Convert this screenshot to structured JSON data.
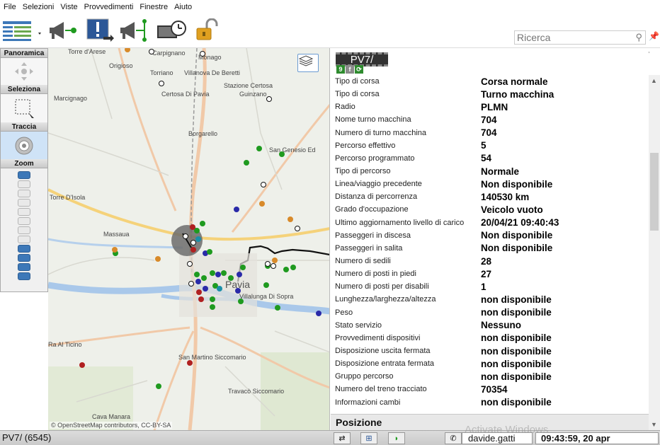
{
  "menu": [
    "File",
    "Selezioni",
    "Viste",
    "Provvedimenti",
    "Finestre",
    "Aiuto"
  ],
  "search": {
    "placeholder": "Ricerca"
  },
  "left_panel": {
    "panoramica": "Panoramica",
    "seleziona": "Seleziona",
    "traccia": "Traccia",
    "zoom": "Zoom",
    "zoom_levels": 12,
    "zoom_active_from": 8
  },
  "map": {
    "place_labels": [
      "Carpignano",
      "Monago",
      "Torre d'Arese",
      "Origioso",
      "Torriano",
      "Villanova De Beretti",
      "Stazione Certosa",
      "Certosa Di Pavia",
      "Guinzano",
      "Marcignago",
      "Borgarello",
      "San Genesio Ed",
      "Torre D'Isola",
      "Massaua",
      "Pavia",
      "Villalunga Di Sopra",
      "Ra Al Ticino",
      "San Martino Siccomario",
      "Travacò Siccomario",
      "Cava Manara"
    ],
    "attribution": "© OpenStreetMap contributors, CC-BY-SA"
  },
  "details": {
    "vehicle_id": "PV7/",
    "badges": [
      {
        "text": "9",
        "color": "#2e8b2e"
      },
      {
        "text": "f",
        "color": "#8a8a8a"
      },
      {
        "text": "⟳",
        "color": "#2e8b2e"
      }
    ],
    "rows": [
      {
        "label": "Tipo di corsa",
        "value": "Corsa normale"
      },
      {
        "label": "Tipo di corsa",
        "value": "Turno macchina"
      },
      {
        "label": "Radio",
        "value": "PLMN"
      },
      {
        "label": "Nome turno macchina",
        "value": "704"
      },
      {
        "label": "Numero di turno macchina",
        "value": "704"
      },
      {
        "label": "Percorso effettivo",
        "value": "5"
      },
      {
        "label": "Percorso programmato",
        "value": "54"
      },
      {
        "label": "Tipo di percorso",
        "value": "Normale"
      },
      {
        "label": "Linea/viaggio precedente",
        "value": "Non disponibile"
      },
      {
        "label": "Distanza di percorrenza",
        "value": "140530 km"
      },
      {
        "label": "Grado d'occupazione",
        "value": "Veicolo vuoto"
      },
      {
        "label": "Ultimo aggiornamento livello di carico",
        "value": "20/04/21 09:40:43"
      },
      {
        "label": "Passeggeri in discesa",
        "value": "Non disponibile"
      },
      {
        "label": "Passeggeri in salita",
        "value": "Non disponibile"
      },
      {
        "label": "Numero di sedili",
        "value": "28"
      },
      {
        "label": "Numero di posti in piedi",
        "value": "27"
      },
      {
        "label": "Numero di posti per disabili",
        "value": "1"
      },
      {
        "label": "Lunghezza/larghezza/altezza",
        "value": "non disponibile"
      },
      {
        "label": "Peso",
        "value": "non disponibile"
      },
      {
        "label": "Stato servizio",
        "value": "Nessuno"
      },
      {
        "label": "Provvedimenti dispositivi",
        "value": "non disponibile"
      },
      {
        "label": "Disposizione uscita fermata",
        "value": "non disponibile"
      },
      {
        "label": "Disposizione entrata fermata",
        "value": "non disponibile"
      },
      {
        "label": "Gruppo percorso",
        "value": "non disponibile"
      },
      {
        "label": "Numero del treno tracciato",
        "value": "70354"
      },
      {
        "label": "Informazioni cambi",
        "value": "non disponibile"
      }
    ],
    "section_position": "Posizione"
  },
  "statusbar": {
    "vehicle": "PV7/ (6545)",
    "user": "davide.gatti",
    "clock": "09:43:59, 20 apr"
  },
  "watermark": "Activate Windows",
  "colors": {
    "accent": "#3d78b8",
    "stop_green": "#1f9a1f",
    "stop_orange": "#d88a2a",
    "stop_blue": "#2a2aa8",
    "stop_red": "#b02020",
    "stop_teal": "#1b8fa8"
  }
}
